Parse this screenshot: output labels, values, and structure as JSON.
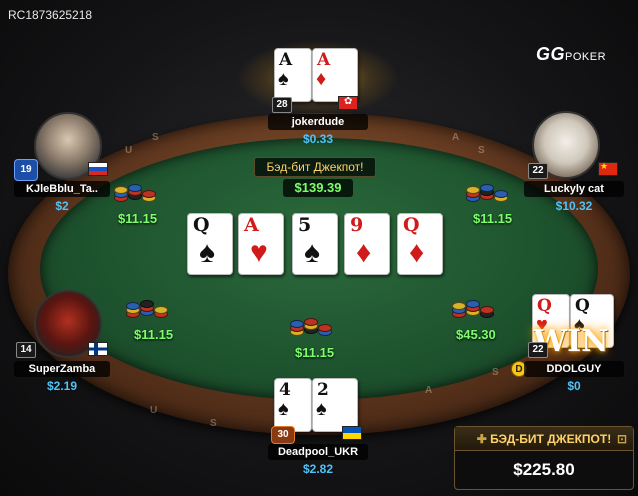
{
  "hand_id": "RC1873625218",
  "brand": {
    "gg": "GG",
    "poker": "POKER"
  },
  "rail_text": [
    "U",
    "S",
    "A",
    "S",
    "U",
    "S",
    "A",
    "S"
  ],
  "pot": {
    "jackpot_label": "Бэд-бит Джекпот!",
    "amount": "$139.39",
    "center_bet": "$11.15"
  },
  "board": [
    {
      "rank": "Q",
      "suit": "♠",
      "color": "black"
    },
    {
      "rank": "A",
      "suit": "♥",
      "color": "red"
    },
    {
      "rank": "5",
      "suit": "♠",
      "color": "black"
    },
    {
      "rank": "9",
      "suit": "♦",
      "color": "red"
    },
    {
      "rank": "Q",
      "suit": "♦",
      "color": "red"
    }
  ],
  "players": {
    "top": {
      "name": "jokerdude",
      "stack": "$0.33",
      "level": "28",
      "cards": [
        {
          "rank": "A",
          "suit": "♠",
          "color": "black"
        },
        {
          "rank": "A",
          "suit": "♦",
          "color": "red"
        }
      ]
    },
    "top_left": {
      "name": "KJleBblu_Ta..",
      "stack": "$2",
      "level": "19",
      "bet": "$11.15"
    },
    "top_right": {
      "name": "Luckyly cat",
      "stack": "$10.32",
      "level": "22",
      "bet": "$11.15"
    },
    "bottom_left": {
      "name": "SuperZamba",
      "stack": "$2.19",
      "level": "14",
      "bet": "$11.15"
    },
    "bottom_right": {
      "name": "DDOLGUY",
      "stack": "$0",
      "level": "22",
      "bet": "$45.30",
      "cards": [
        {
          "rank": "Q",
          "suit": "♥",
          "color": "red"
        },
        {
          "rank": "Q",
          "suit": "♠",
          "color": "black"
        }
      ],
      "badge": "WIN",
      "dealer": "D"
    },
    "bottom": {
      "name": "Deadpool_UKR",
      "stack": "$2.82",
      "level": "30",
      "cards": [
        {
          "rank": "4",
          "suit": "♠",
          "color": "black"
        },
        {
          "rank": "2",
          "suit": "♠",
          "color": "black"
        }
      ]
    }
  },
  "jackpot_panel": {
    "title": "БЭД-БИТ ДЖЕКПОТ!",
    "amount": "$225.80"
  },
  "colors": {
    "accent_green": "#7cff6a",
    "stack_blue": "#4fc3f7",
    "gold": "#ffd36a"
  }
}
